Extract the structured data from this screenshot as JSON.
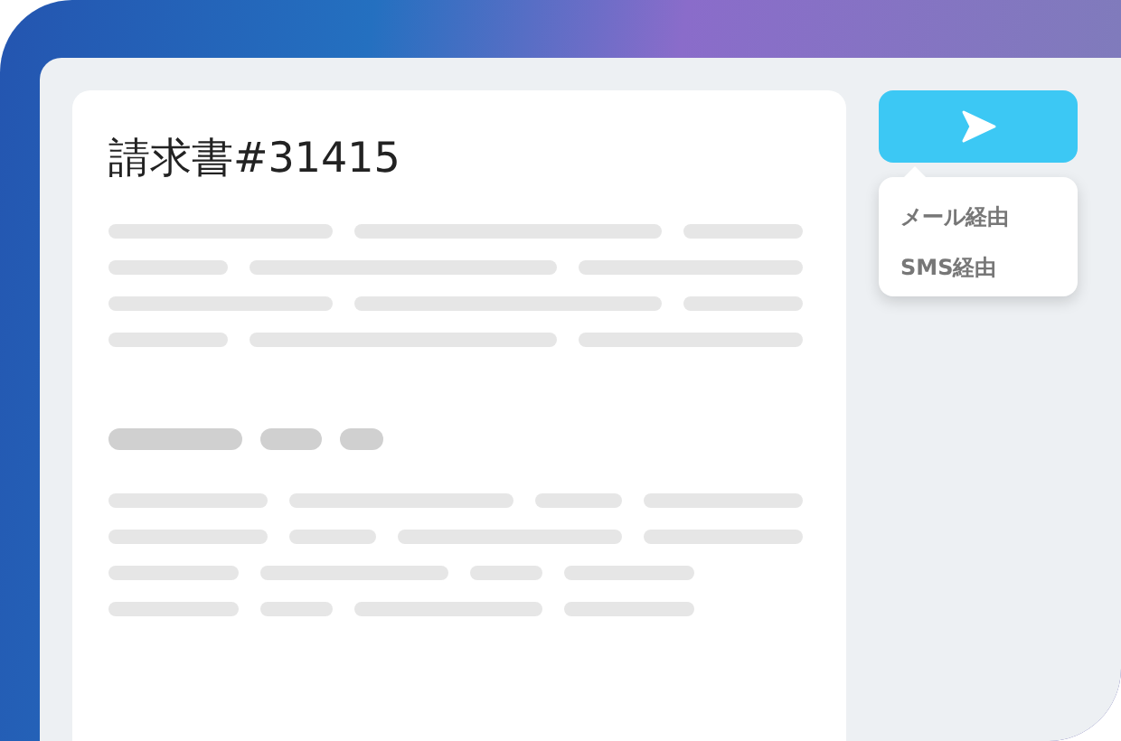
{
  "invoice": {
    "title": "請求書#31415"
  },
  "send_menu": {
    "items": [
      {
        "label": "メール経由"
      },
      {
        "label": "SMS経由"
      }
    ]
  }
}
